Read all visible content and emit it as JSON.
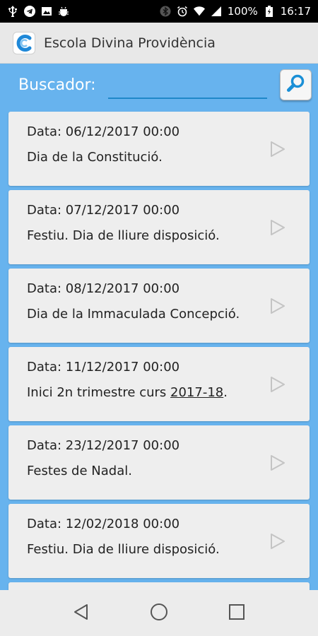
{
  "status_bar": {
    "battery": "100%",
    "time": "16:17"
  },
  "app": {
    "title": "Escola Divina Providència"
  },
  "search": {
    "label": "Buscador:",
    "value": "",
    "placeholder": ""
  },
  "events": [
    {
      "date": "Data: 06/12/2017 00:00",
      "desc": "Dia de la Constitució.",
      "desc_pre": "",
      "desc_link": "",
      "desc_post": ""
    },
    {
      "date": "Data: 07/12/2017 00:00",
      "desc": "Festiu. Dia de lliure disposició.",
      "desc_pre": "",
      "desc_link": "",
      "desc_post": ""
    },
    {
      "date": "Data: 08/12/2017 00:00",
      "desc": "Dia de la Immaculada Concepció.",
      "desc_pre": "",
      "desc_link": "",
      "desc_post": ""
    },
    {
      "date": "Data: 11/12/2017 00:00",
      "desc": "",
      "desc_pre": "Inici 2n trimestre curs ",
      "desc_link": "2017-18",
      "desc_post": "."
    },
    {
      "date": "Data: 23/12/2017 00:00",
      "desc": "Festes de Nadal.",
      "desc_pre": "",
      "desc_link": "",
      "desc_post": ""
    },
    {
      "date": "Data: 12/02/2018 00:00",
      "desc": "Festiu. Dia de lliure disposició.",
      "desc_pre": "",
      "desc_link": "",
      "desc_post": ""
    }
  ],
  "colors": {
    "main_bg": "#67b3ee",
    "accent": "#1f88c9",
    "card_bg": "#eeeeee"
  }
}
